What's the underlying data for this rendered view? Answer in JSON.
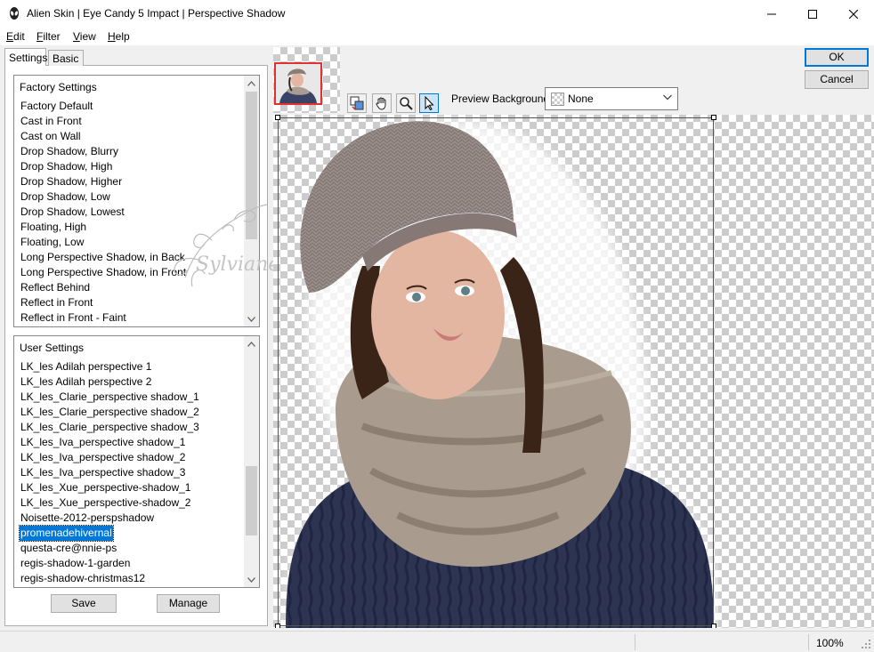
{
  "window": {
    "title": "Alien Skin | Eye Candy 5 Impact | Perspective Shadow"
  },
  "menu": {
    "items": [
      {
        "label": "dit",
        "key": "E"
      },
      {
        "label": "ilter",
        "key": "F"
      },
      {
        "label": "iew",
        "key": "V"
      },
      {
        "label": "elp",
        "key": "H"
      }
    ]
  },
  "tabs": {
    "settings": "Settings",
    "basic": "Basic"
  },
  "factory": {
    "header": "Factory Settings",
    "items": [
      "Factory Default",
      "Cast in Front",
      "Cast on Wall",
      "Drop Shadow, Blurry",
      "Drop Shadow, High",
      "Drop Shadow, Higher",
      "Drop Shadow, Low",
      "Drop Shadow, Lowest",
      "Floating, High",
      "Floating, Low",
      "Long Perspective Shadow, in Back",
      "Long Perspective Shadow, in Front",
      "Reflect Behind",
      "Reflect in Front",
      "Reflect in Front - Faint"
    ]
  },
  "user": {
    "header": "User Settings",
    "items": [
      "LK_les Adilah perspective 1",
      "LK_les Adilah perspective 2",
      "LK_les_Clarie_perspective shadow_1",
      "LK_les_Clarie_perspective shadow_2",
      "LK_les_Clarie_perspective shadow_3",
      "LK_les_Iva_perspective shadow_1",
      "LK_les_Iva_perspective shadow_2",
      "LK_les_Iva_perspective shadow_3",
      "LK_les_Xue_perspective-shadow_1",
      "LK_les_Xue_perspective-shadow_2",
      "Noisette-2012-perspshadow",
      "promenadehivernal",
      "questa-cre@nnie-ps",
      "regis-shadow-1-garden",
      "regis-shadow-christmas12"
    ],
    "selected_index": 11
  },
  "buttons": {
    "save": "Save",
    "manage": "Manage",
    "ok": "OK",
    "cancel": "Cancel"
  },
  "preview_background": {
    "label": "Preview Background:",
    "value": "None"
  },
  "watermark": {
    "text": "Sylviane"
  },
  "status": {
    "zoom": "100%"
  },
  "colors": {
    "selection": "#0078d7",
    "navigator_frame": "#e03030"
  }
}
